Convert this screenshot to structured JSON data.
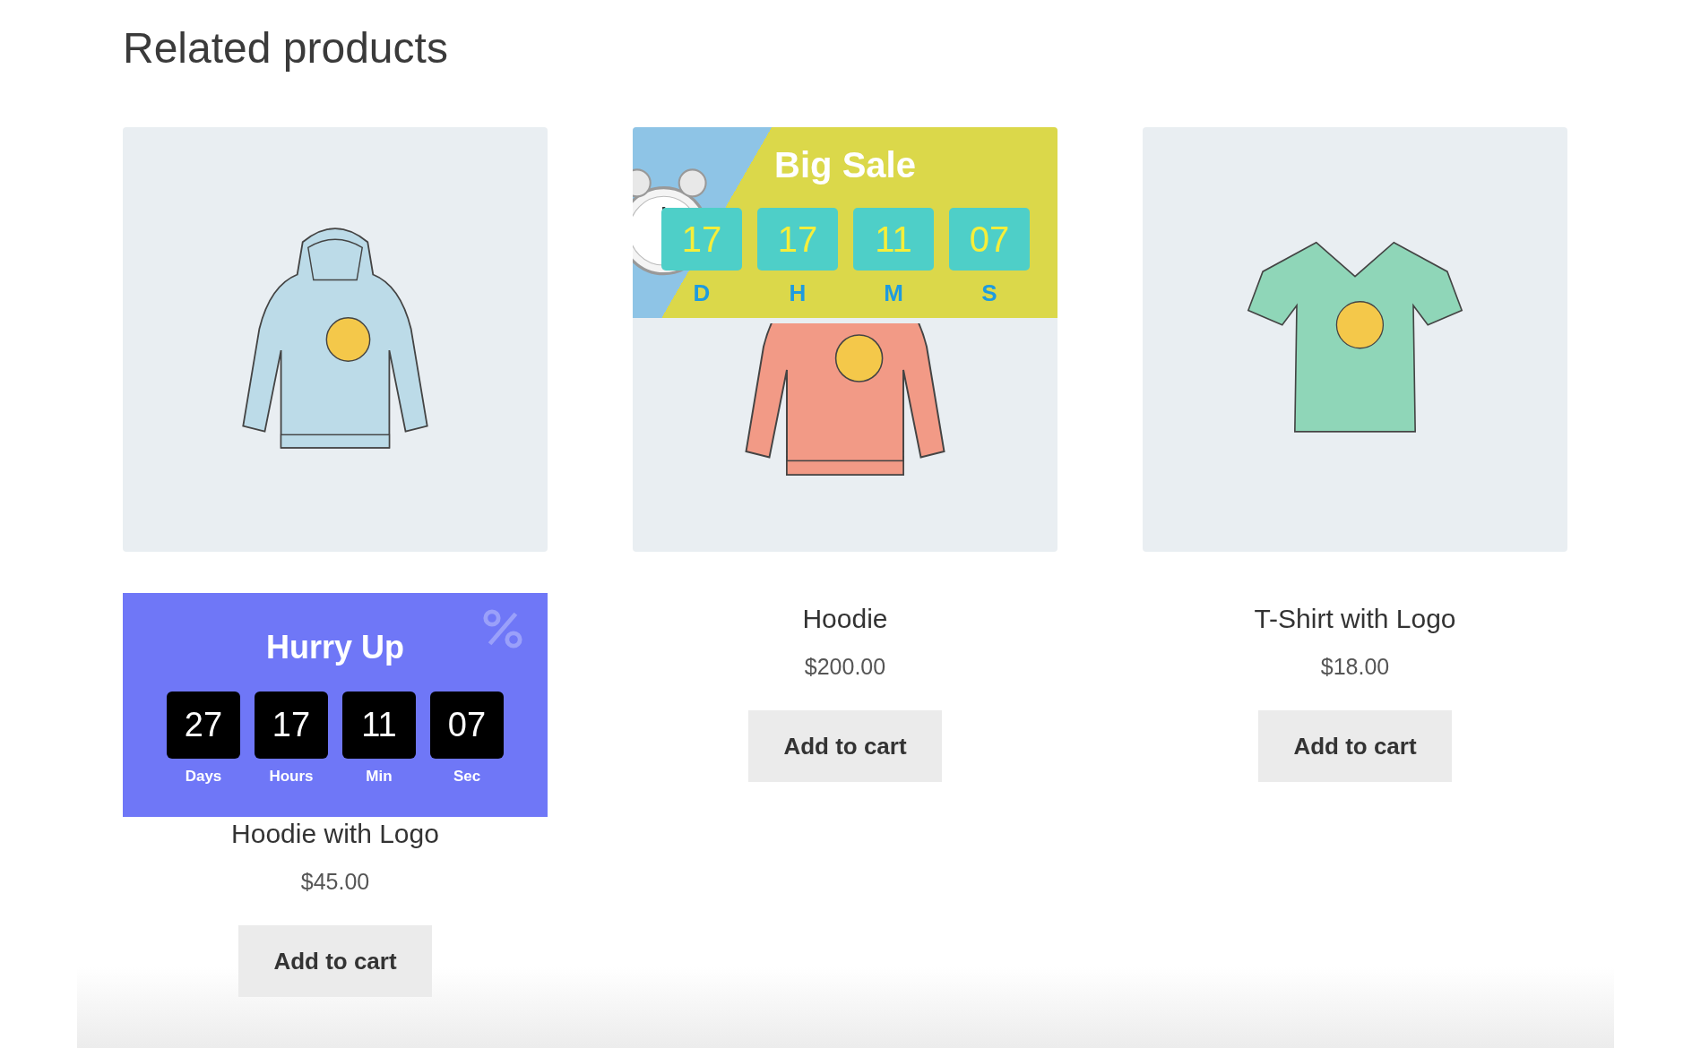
{
  "section_title": "Related products",
  "products": [
    {
      "name": "Hoodie with Logo",
      "price": "$45.00",
      "button": "Add to cart",
      "kind": "hoodie",
      "color": "#bcdbe8",
      "countdown": {
        "kind": "hurry",
        "title": "Hurry Up",
        "units": [
          {
            "value": "27",
            "label": "Days"
          },
          {
            "value": "17",
            "label": "Hours"
          },
          {
            "value": "11",
            "label": "Min"
          },
          {
            "value": "07",
            "label": "Sec"
          }
        ]
      }
    },
    {
      "name": "Hoodie",
      "price": "$200.00",
      "button": "Add to cart",
      "kind": "hoodie",
      "color": "#f29a86",
      "countdown": {
        "kind": "big_sale",
        "title": "Big Sale",
        "units": [
          {
            "value": "17",
            "label": "D"
          },
          {
            "value": "17",
            "label": "H"
          },
          {
            "value": "11",
            "label": "M"
          },
          {
            "value": "07",
            "label": "S"
          }
        ]
      }
    },
    {
      "name": "T-Shirt with Logo",
      "price": "$18.00",
      "button": "Add to cart",
      "kind": "tshirt",
      "color": "#8fd6b8"
    }
  ]
}
